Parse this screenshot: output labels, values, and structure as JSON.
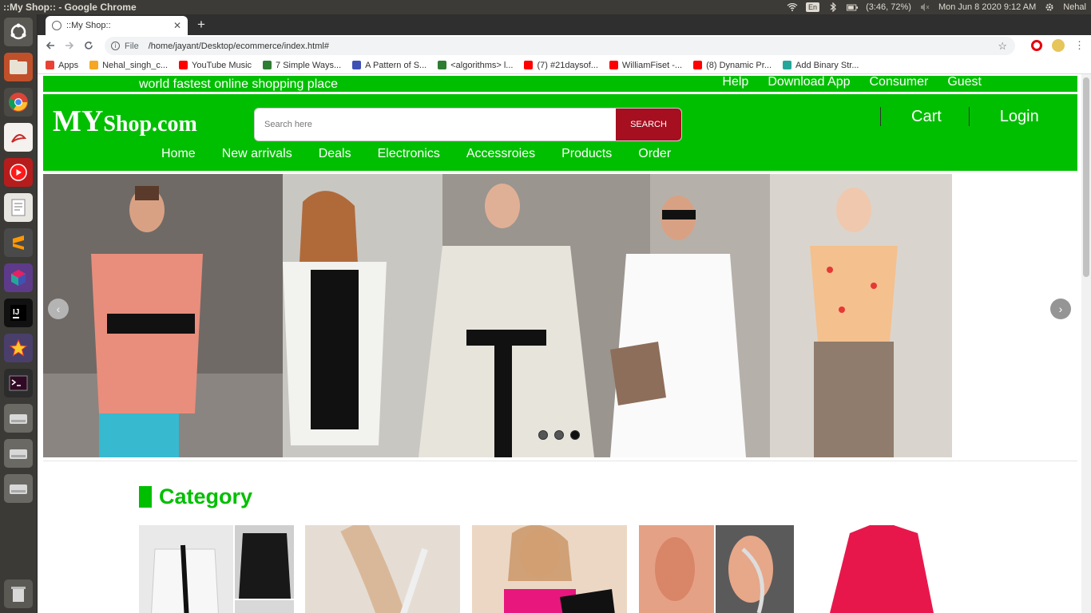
{
  "os": {
    "window_title": "::My Shop:: - Google Chrome",
    "keyboard": "En",
    "battery": "(3:46, 72%)",
    "clock": "Mon Jun  8 2020  9:12 AM",
    "user": "Nehal"
  },
  "browser": {
    "tab_title": "::My Shop::",
    "new_tab": "+",
    "address_scheme": "File",
    "address_url": "/home/jayant/Desktop/ecommerce/index.html#",
    "bookmarks": [
      {
        "label": "Apps",
        "color": "#e94235"
      },
      {
        "label": "Nehal_singh_c...",
        "color": "#f5a623"
      },
      {
        "label": "YouTube Music",
        "color": "#ff0000"
      },
      {
        "label": "7 Simple Ways...",
        "color": "#2e7d32"
      },
      {
        "label": "A Pattern of S...",
        "color": "#3f51b5"
      },
      {
        "label": "<algorithms> l...",
        "color": "#2e7d32"
      },
      {
        "label": "(7) #21daysof...",
        "color": "#ff0000"
      },
      {
        "label": "WilliamFiset -...",
        "color": "#ff0000"
      },
      {
        "label": "(8) Dynamic Pr...",
        "color": "#ff0000"
      },
      {
        "label": "Add Binary Str...",
        "color": "#26a69a"
      }
    ]
  },
  "site": {
    "slogan": "world fastest online shopping place",
    "top_links": [
      "Help",
      "Download App",
      "Consumer",
      "Guest"
    ],
    "logo_big": "MY",
    "logo_small": "Shop.com",
    "search_placeholder": "Search here",
    "search_button": "SEARCH",
    "cart": "Cart",
    "login": "Login",
    "nav": [
      "Home",
      "New arrivals",
      "Deals",
      "Electronics",
      "Accessroies",
      "Products",
      "Order"
    ],
    "carousel_prev": "‹",
    "carousel_next": "›",
    "carousel_active_index": 2,
    "category_title": "Category"
  },
  "colors": {
    "brand_green": "#00bf00",
    "search_button": "#a50f1f"
  }
}
